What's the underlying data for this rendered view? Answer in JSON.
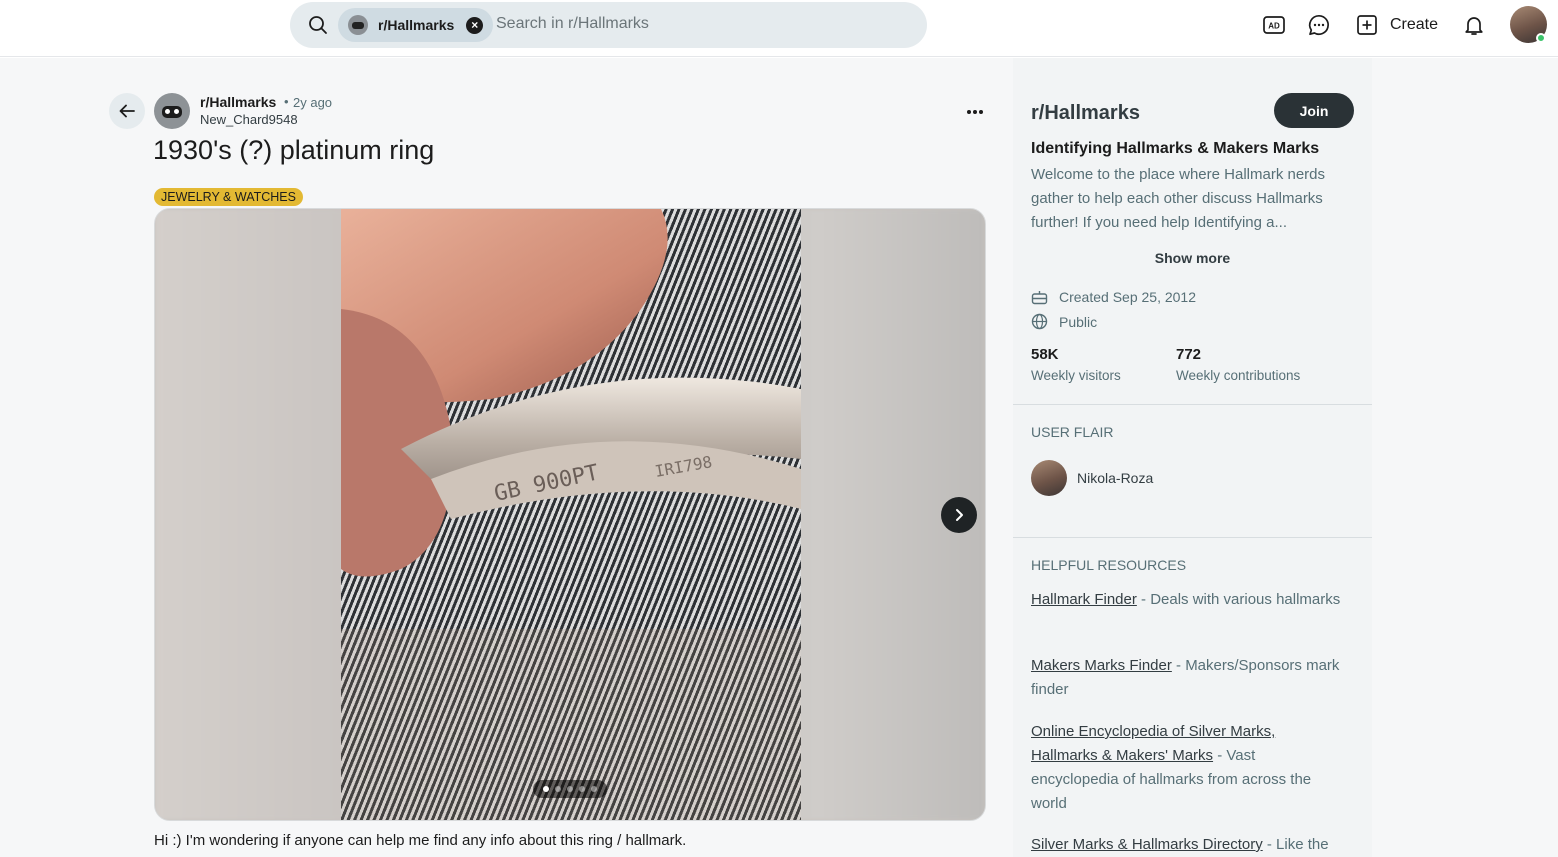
{
  "search": {
    "chip_label": "r/Hallmarks",
    "placeholder": "Search in r/Hallmarks"
  },
  "header": {
    "create_label": "Create"
  },
  "post": {
    "subreddit": "r/Hallmarks",
    "separator": "•",
    "age": "2y ago",
    "author": "New_Chard9548",
    "title": "1930's (?) platinum ring",
    "flair": "JEWELRY & WATCHES",
    "body": "Hi :) I'm wondering if anyone can help me find any info about this ring / hallmark.",
    "gallery": {
      "image_count": 5,
      "current_index": 1,
      "engraving": "GB 900PT IRI"
    }
  },
  "sidebar": {
    "title": "r/Hallmarks",
    "join_label": "Join",
    "headline": "Identifying Hallmarks & Makers Marks",
    "description": "Welcome to the place where Hallmark nerds gather to help each other discuss Hallmarks further! If you need help Identifying a...",
    "show_more": "Show more",
    "created": "Created Sep 25, 2012",
    "visibility": "Public",
    "stats": {
      "visitors_value": "58K",
      "visitors_label": "Weekly visitors",
      "contrib_value": "772",
      "contrib_label": "Weekly contributions"
    },
    "user_flair_heading": "USER FLAIR",
    "user_flair_name": "Nikola-Roza",
    "resources_heading": "HELPFUL RESOURCES",
    "resources": [
      {
        "link": "Hallmark Finder",
        "desc": " - Deals with various hallmarks"
      },
      {
        "link": "Makers Marks Finder",
        "desc": " - Makers/Sponsors mark finder"
      },
      {
        "link": "Online Encyclopedia of Silver Marks, Hallmarks & Makers' Marks",
        "desc": " - Vast encyclopedia of hallmarks from across the world"
      },
      {
        "link": "Silver Marks & Hallmarks Directory",
        "desc": " - Like the"
      }
    ]
  },
  "colors": {
    "flair_bg": "#e3b933",
    "join_bg": "#2a3236",
    "online": "#3cc46b"
  }
}
